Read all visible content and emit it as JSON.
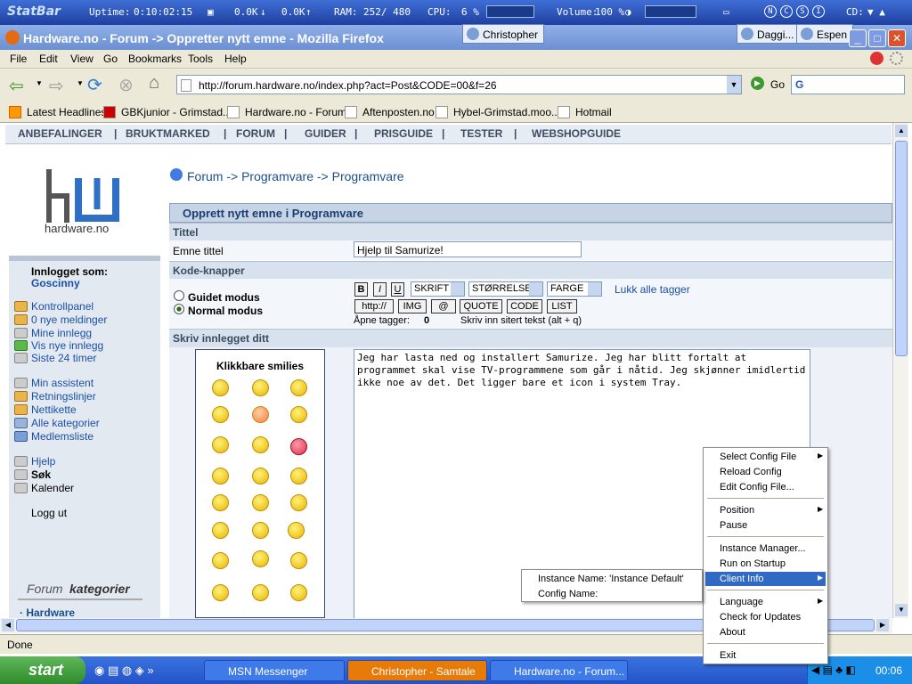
{
  "statbar": {
    "brand": "StatBar",
    "uptime_label": "Uptime:",
    "uptime": "0:10:02:15",
    "net_down": "0.0K",
    "net_up": "0.0K",
    "ram_label": "RAM:",
    "ram": "252/ 480",
    "cpu_label": "CPU:",
    "cpu": "6 %",
    "volume_label": "Volume:",
    "volume": "100 %",
    "cd_label": "CD:",
    "buttons": [
      "N",
      "C",
      "S",
      "I"
    ]
  },
  "window": {
    "title": "Hardware.no - Forum -> Oppretter nytt emne - Mozilla Firefox",
    "msn_tabs": [
      "Christopher",
      "Daggi...",
      "Espen"
    ]
  },
  "menu": [
    "File",
    "Edit",
    "View",
    "Go",
    "Bookmarks",
    "Tools",
    "Help"
  ],
  "nav": {
    "url": "http://forum.hardware.no/index.php?act=Post&CODE=00&f=26",
    "go_label": "Go"
  },
  "bookmarks": [
    "Latest Headlines",
    "GBKjunior - Grimstad...",
    "Hardware.no - Forum",
    "Aftenposten.no",
    "Hybel-Grimstad.moo...",
    "Hotmail"
  ],
  "topnav": [
    "ANBEFALINGER",
    "|",
    "BRUKTMARKED",
    "|",
    "FORUM",
    "|",
    "GUIDER",
    "|",
    "PRISGUIDE",
    "|",
    "TESTER",
    "|",
    "WEBSHOPGUIDE"
  ],
  "sidebar": {
    "logo_text": "hardware.no",
    "logged_in_label": "Innlogget som:",
    "username": "Goscinny",
    "links1": [
      "Kontrollpanel",
      "0 nye meldinger",
      "Mine innlegg",
      "Vis nye innlegg",
      "Siste 24 timer"
    ],
    "links2": [
      "Min assistent",
      "Retningslinjer",
      "Nettikette",
      "Alle kategorier",
      "Medlemsliste"
    ],
    "links3": [
      "Hjelp",
      "Søk",
      "Kalender"
    ],
    "logout": "Logg ut",
    "forum_cat_a": "Forum",
    "forum_cat_b": "kategorier",
    "first_cat": "Hardware"
  },
  "main": {
    "crumb": "Forum -> Programvare -> Programvare",
    "header": "Opprett nytt emne i Programvare",
    "tittel": "Tittel",
    "emne_label": "Emne tittel",
    "emne_value": "Hjelp til Samurize!",
    "kode_label": "Kode-knapper",
    "mode_guided": "Guidet modus",
    "mode_normal": "Normal modus",
    "btn_b": "B",
    "btn_i": "I",
    "btn_u": "U",
    "sel_font": "SKRIFT",
    "sel_size": "STØRRELSE",
    "sel_color": "FARGE",
    "close_tags": "Lukk alle tagger",
    "btn_http": "http://",
    "btn_img": "IMG",
    "btn_at": "@",
    "btn_quote": "QUOTE",
    "btn_code": "CODE",
    "btn_list": "LIST",
    "open_tags_label": "Åpne tagger:",
    "open_tags_value": "0",
    "quote_hint": "Skriv inn sitert tekst (alt + q)",
    "write_label": "Skriv innlegget ditt",
    "smilies_title": "Klikkbare smilies",
    "post_text": "Jeg har lasta ned og installert Samurize. Jeg har blitt fortalt at programmet skal vise TV-programmene som går i nåtid. Jeg skjønner imidlertid ikke noe av det. Det ligger bare et icon i system Tray."
  },
  "context_menu": {
    "items": [
      "Select Config File",
      "Reload Config",
      "Edit Config File...",
      "Position",
      "Pause",
      "Instance Manager...",
      "Run on Startup",
      "Client Info",
      "Language",
      "Check for Updates",
      "About",
      "Exit"
    ],
    "submenu": [
      "Instance Name: 'Instance Default'",
      "Config Name:"
    ]
  },
  "status": "Done",
  "taskbar": {
    "start": "start",
    "tasks": [
      "MSN Messenger",
      "Christopher - Samtale",
      "Hardware.no - Forum..."
    ],
    "clock": "00:06"
  }
}
